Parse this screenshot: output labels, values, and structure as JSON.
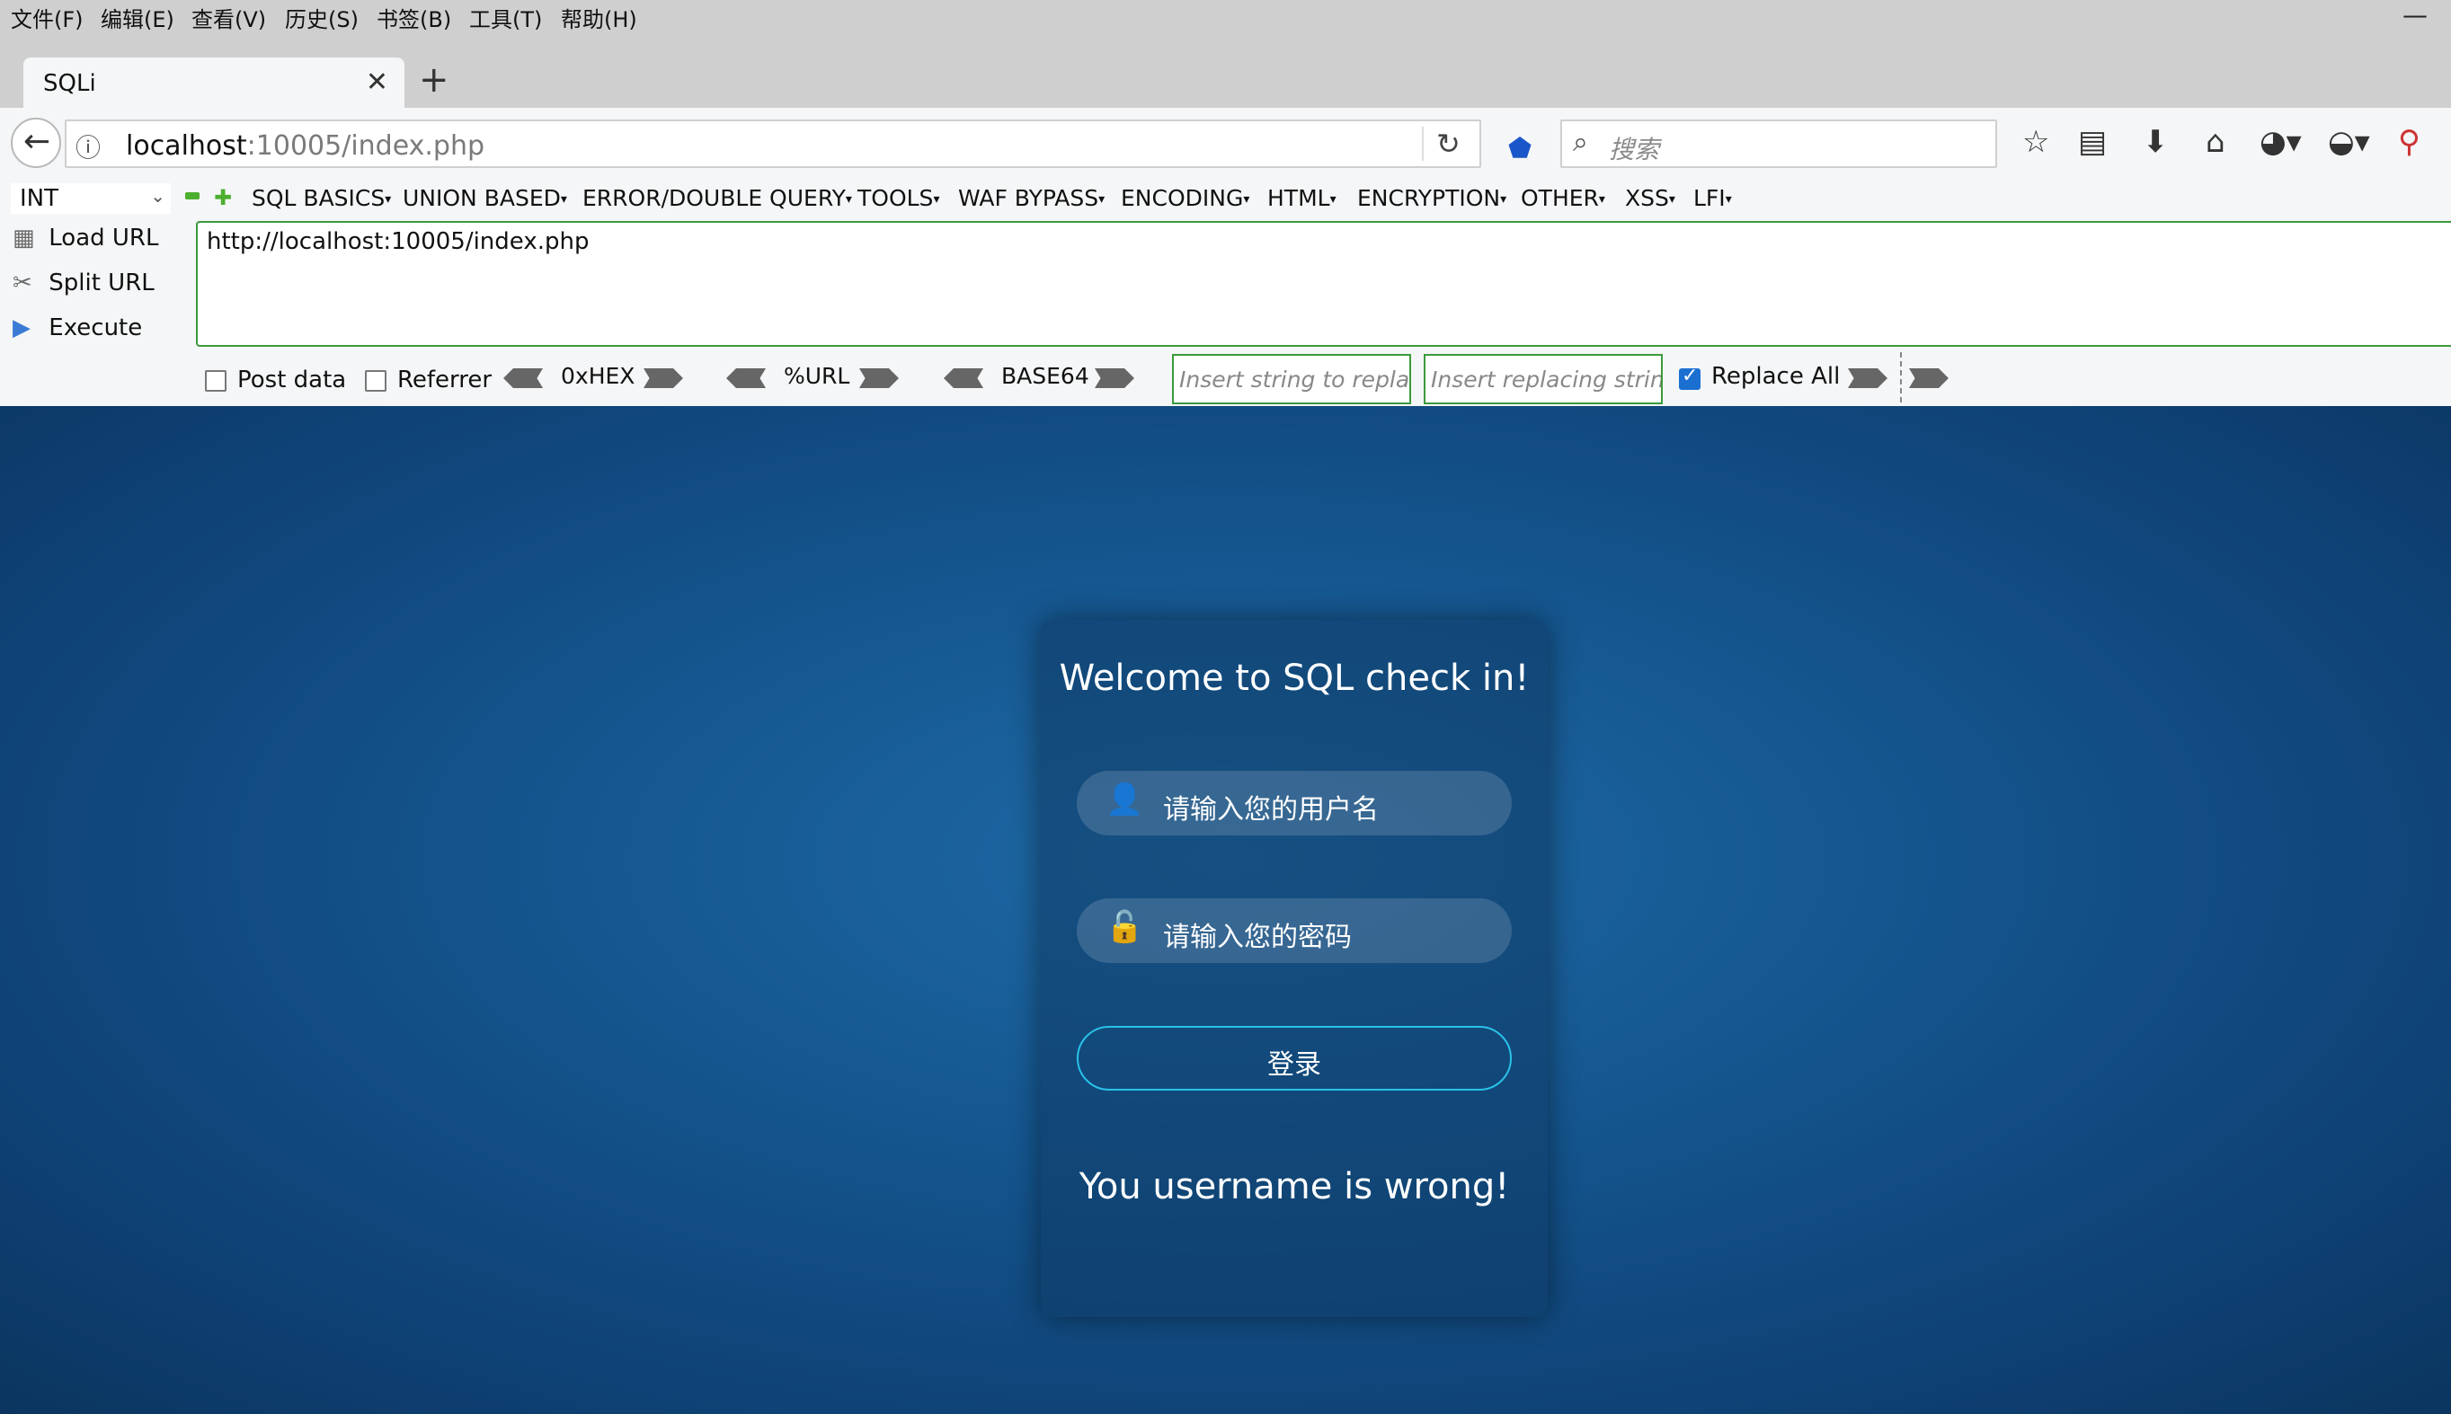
{
  "menu": {
    "items": [
      "文件(F)",
      "编辑(E)",
      "查看(V)",
      "历史(S)",
      "书签(B)",
      "工具(T)",
      "帮助(H)"
    ],
    "minimize": "—"
  },
  "tab": {
    "title": "SQLi",
    "close": "✕",
    "new_tab": "+"
  },
  "nav": {
    "url_host": "localhost",
    "url_path": ":10005/index.php",
    "search_placeholder": "搜索"
  },
  "hackbar": {
    "type_select": "INT",
    "menus": [
      "SQL BASICS",
      "UNION BASED",
      "ERROR/DOUBLE QUERY",
      "TOOLS",
      "WAF BYPASS",
      "ENCODING",
      "HTML",
      "ENCRYPTION",
      "OTHER",
      "XSS",
      "LFI"
    ],
    "load_url": "Load URL",
    "split_url": "Split URL",
    "execute": "Execute",
    "url_value": "http://localhost:10005/index.php",
    "post_data": "Post data",
    "referrer": "Referrer",
    "hex": "0xHEX",
    "urlenc": "%URL",
    "base64": "BASE64",
    "replace_placeholder": "Insert string to replace",
    "replacing_placeholder": "Insert replacing string",
    "replace_all": "Replace All",
    "replace_all_checked": true
  },
  "login": {
    "title": "Welcome to SQL check in!",
    "username_placeholder": "请输入您的用户名",
    "password_placeholder": "请输入您的密码",
    "submit": "登录",
    "message": "You username is wrong!"
  },
  "colors": {
    "accent_green": "#3b9a3b",
    "button_border": "#2ac1e8",
    "page_bg": "#14558e"
  }
}
